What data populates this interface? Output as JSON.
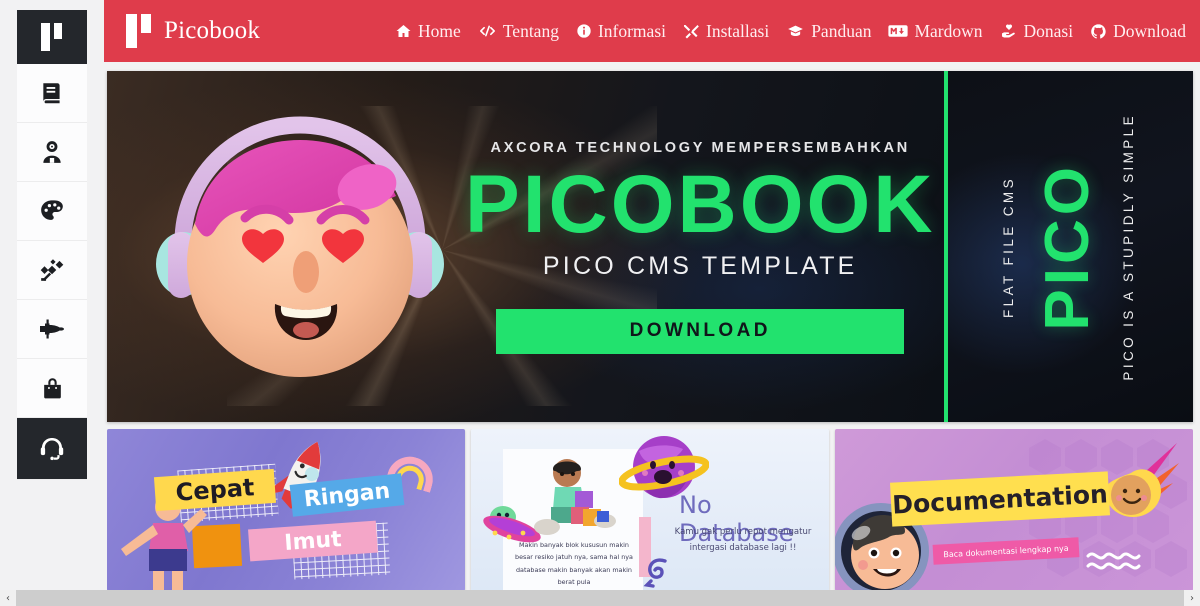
{
  "header": {
    "brand": "Picobook",
    "logo_icon": "picobook-logo-icon",
    "nav": [
      {
        "label": "Home",
        "icon": "home-icon"
      },
      {
        "label": "Tentang",
        "icon": "code-icon"
      },
      {
        "label": "Informasi",
        "icon": "info-circle-icon"
      },
      {
        "label": "Installasi",
        "icon": "tools-icon"
      },
      {
        "label": "Panduan",
        "icon": "graduation-cap-icon"
      },
      {
        "label": "Mardown",
        "icon": "markdown-icon"
      },
      {
        "label": "Donasi",
        "icon": "hand-holding-heart-icon"
      },
      {
        "label": "Download",
        "icon": "github-icon"
      }
    ]
  },
  "sidebar": {
    "items": [
      {
        "icon": "picobook-logo-icon",
        "state": "logo"
      },
      {
        "icon": "book-icon",
        "state": "default"
      },
      {
        "icon": "user-astronaut-icon",
        "state": "default"
      },
      {
        "icon": "palette-icon",
        "state": "default"
      },
      {
        "icon": "satellite-icon",
        "state": "default"
      },
      {
        "icon": "space-shuttle-icon",
        "state": "default"
      },
      {
        "icon": "shopping-bag-icon",
        "state": "default"
      },
      {
        "icon": "headset-icon",
        "state": "active"
      }
    ]
  },
  "hero": {
    "kicker": "AXCORA TECHNOLOGY MEMPERSEMBAHKAN",
    "title": "PICOBOOK",
    "subtitle": "PICO CMS TEMPLATE",
    "download_label": "DOWNLOAD",
    "face_icon": "emoji-heart-eyes-headphones-icon",
    "accent_green": "#22e26e",
    "brand_red": "#df3c4b",
    "side_panel": {
      "left_text": "FLAT FILE CMS",
      "center_text": "PICO",
      "right_text": "PICO IS A STUPIDLY SIMPLE"
    }
  },
  "cards": [
    {
      "name": "card-cepat-ringan-imut",
      "banners": [
        "Cepat",
        "Ringan",
        "Imut"
      ],
      "icons": [
        "rocket-icon",
        "rainbow-icon",
        "figure-icon"
      ]
    },
    {
      "name": "card-no-database",
      "title": "No Database",
      "caption": "Kamu gak perlu repot mengatur intergasi database lagi !!",
      "body": "Makin banyak blok kususun makin besar resiko jatuh nya, sama hal nya database makin banyak akan makin berat pula",
      "icons": [
        "planet-icon",
        "ufo-icon",
        "kid-blocks-icon"
      ]
    },
    {
      "name": "card-documentation",
      "title": "Documentation",
      "caption": "Baca dokumentasi lengkap nya",
      "icons": [
        "comet-icon",
        "astronaut-icon",
        "hexagon-pattern-icon"
      ]
    }
  ],
  "scrollbar": {
    "left_arrow": "‹",
    "right_arrow": "›"
  }
}
